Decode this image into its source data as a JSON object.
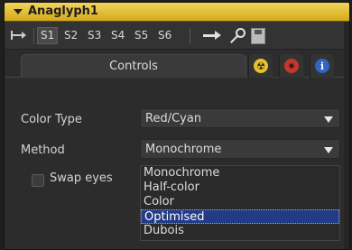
{
  "header": {
    "title": "Anaglyph1"
  },
  "toolbar": {
    "slots": [
      "S1",
      "S2",
      "S3",
      "S4",
      "S5",
      "S6"
    ],
    "active_slot": "S1"
  },
  "tabs": {
    "controls_label": "Controls",
    "icons": [
      "radiation-icon",
      "gear-icon",
      "info-icon"
    ]
  },
  "controls": {
    "color_type": {
      "label": "Color Type",
      "value": "Red/Cyan"
    },
    "method": {
      "label": "Method",
      "value": "Monochrome"
    },
    "swap_eyes": {
      "label": "Swap eyes",
      "checked": false
    }
  },
  "method_dropdown": {
    "options": [
      "Monochrome",
      "Half-color",
      "Color",
      "Optimised",
      "Dubois"
    ],
    "highlighted": "Optimised"
  },
  "colors": {
    "header_gold": "#e6c23a",
    "selection_blue": "#233a86",
    "radiation_yellow": "#e8c22a",
    "gear_red": "#c0392b",
    "info_blue": "#2f66c4"
  }
}
